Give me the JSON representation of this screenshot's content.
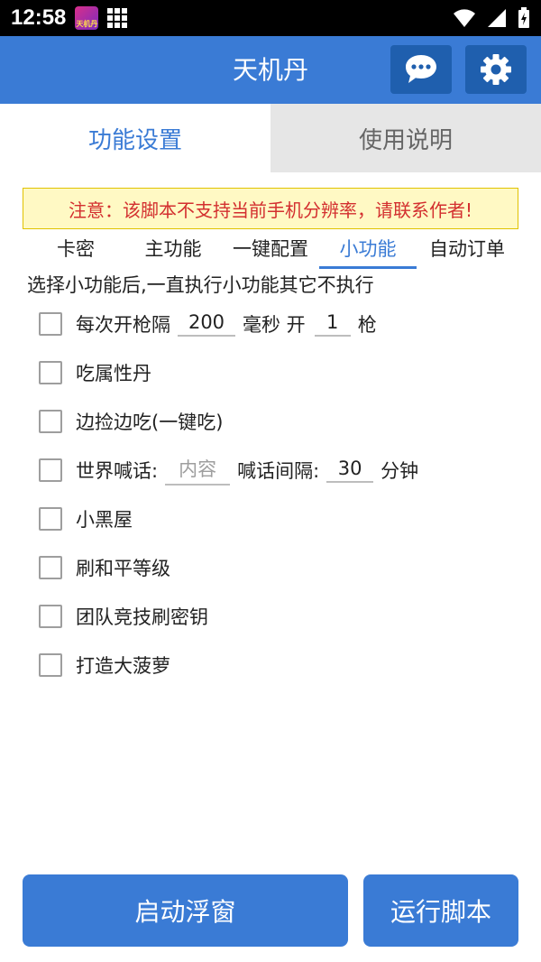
{
  "statusbar": {
    "time": "12:58",
    "app_icon_text": "天机丹"
  },
  "header": {
    "title": "天机丹"
  },
  "main_tabs": [
    {
      "label": "功能设置",
      "active": true
    },
    {
      "label": "使用说明",
      "active": false
    }
  ],
  "notice": "注意：该脚本不支持当前手机分辨率，请联系作者!",
  "sub_tabs": [
    {
      "label": "卡密",
      "active": false
    },
    {
      "label": "主功能",
      "active": false
    },
    {
      "label": "一键配置",
      "active": false
    },
    {
      "label": "小功能",
      "active": true
    },
    {
      "label": "自动订单",
      "active": false
    }
  ],
  "hint": "选择小功能后,一直执行小功能其它不执行",
  "options": {
    "fire_interval": {
      "label": "每次开枪隔",
      "interval_value": "200",
      "unit": "毫秒 开",
      "shots_value": "1",
      "shots_unit": "枪",
      "checked": false
    },
    "eat_attr_pill": {
      "label": "吃属性丹",
      "checked": false
    },
    "pick_and_eat": {
      "label": "边捡边吃(一键吃)",
      "checked": false
    },
    "world_shout": {
      "label": "世界喊话:",
      "content_placeholder": "内容",
      "interval_label": "喊话间隔:",
      "interval_value": "30",
      "interval_unit": "分钟",
      "checked": false
    },
    "black_room": {
      "label": "小黑屋",
      "checked": false
    },
    "peace_level": {
      "label": "刷和平等级",
      "checked": false
    },
    "team_keys": {
      "label": "团队竞技刷密钥",
      "checked": false
    },
    "pineapple": {
      "label": "打造大菠萝",
      "checked": false
    }
  },
  "buttons": {
    "float_window": "启动浮窗",
    "run_script": "运行脚本"
  },
  "colors": {
    "primary": "#3a7bd5",
    "primary_dark": "#1f5fae",
    "notice_text": "#d32f2f",
    "notice_bg": "#fff9c4"
  }
}
